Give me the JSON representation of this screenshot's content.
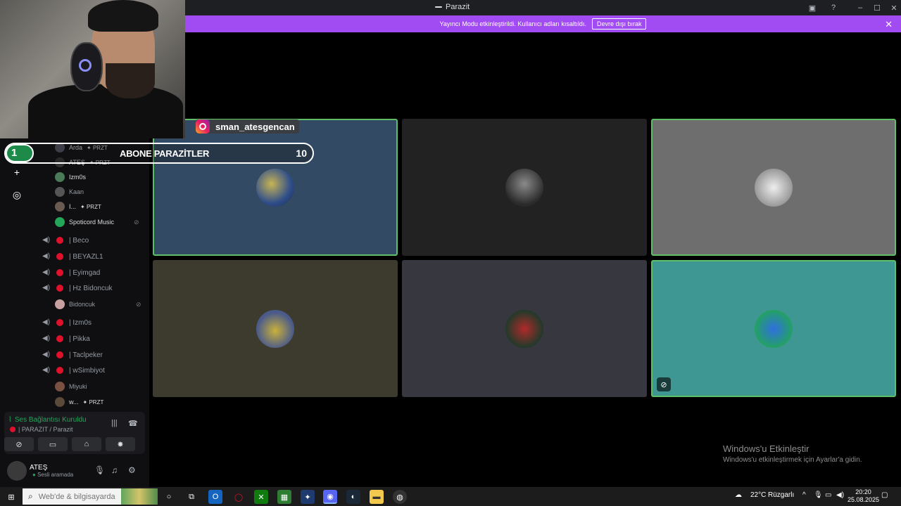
{
  "window": {
    "title": "Parazit"
  },
  "banner": {
    "message": "Yayıncı Modu etkinleştirildi. Kullanıcı adları kısaltıldı.",
    "disable_label": "Devre dışı bırak"
  },
  "overlays": {
    "instagram_handle": "sman_atesgencan",
    "subgoal": {
      "current": "1",
      "label": "ABONE PARAZİTLER",
      "target": "10",
      "progress_fraction": 0.1
    }
  },
  "members_top": [
    {
      "name": "Arda",
      "tag": "PRZT"
    },
    {
      "name": "ATEŞ",
      "tag": "PRZT"
    },
    {
      "name": "Izm0s",
      "tag": ""
    },
    {
      "name": "Kaan",
      "tag": ""
    },
    {
      "name": "I...",
      "tag": "PRZT"
    },
    {
      "name": "Spoticord Music",
      "tag": ""
    }
  ],
  "channels_a": [
    {
      "name": "| Beco"
    },
    {
      "name": "| BEYAZL1"
    },
    {
      "name": "| Eyimgad"
    },
    {
      "name": "| Hz Bidoncuk"
    }
  ],
  "member_bidoncuk": {
    "name": "Bidoncuk"
  },
  "channels_b": [
    {
      "name": "| Izm0s"
    },
    {
      "name": "| Pikka"
    },
    {
      "name": "| Taclpeker"
    },
    {
      "name": "| wSimbiyot"
    }
  ],
  "members_bottom": [
    {
      "name": "Miyuki",
      "tag": ""
    },
    {
      "name": "w...",
      "tag": "PRZT"
    }
  ],
  "voice": {
    "status": "Ses Bağlantısı Kuruldu",
    "channel": "| PARAZIT / Parazit"
  },
  "user": {
    "name": "ATEŞ",
    "status": "Sesli aramada"
  },
  "watermark": {
    "title": "Windows'u Etkinleştir",
    "subtitle": "Windows'u etkinleştirmek için Ayarlar'a gidin."
  },
  "taskbar": {
    "search_placeholder": "Web'de & bilgisayarda",
    "weather": "22°C",
    "weather_label": "Rüzgarlı",
    "time": "20:20",
    "date": "25.08.2025"
  },
  "colors": {
    "accent_banner": "#a14cf2",
    "speaking_border": "#5fbf69",
    "connected_green": "#23a55a",
    "live_red": "#e0112b"
  }
}
